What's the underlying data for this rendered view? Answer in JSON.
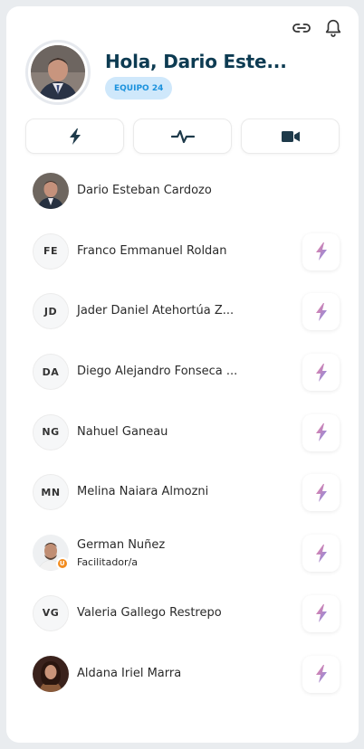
{
  "header": {
    "greeting": "Hola, Dario Este...",
    "team_badge": "EQUIPO 24",
    "icons": [
      "link-icon",
      "bell-icon"
    ]
  },
  "actions": [
    {
      "icon": "bolt-icon"
    },
    {
      "icon": "pulse-icon"
    },
    {
      "icon": "video-camera-icon"
    }
  ],
  "members": [
    {
      "name": "Dario Esteban Cardozo",
      "avatar": "photo",
      "self": true
    },
    {
      "name": "Franco Emmanuel Roldan",
      "initials": "FE"
    },
    {
      "name": "Jader Daniel Atehortúa Z...",
      "initials": "JD"
    },
    {
      "name": "Diego Alejandro Fonseca ...",
      "initials": "DA"
    },
    {
      "name": "Nahuel Ganeau",
      "initials": "NG"
    },
    {
      "name": "Melina Naiara Almozni",
      "initials": "MN"
    },
    {
      "name": "German Nuñez",
      "role": "Facilitador/a",
      "avatar": "photo",
      "badge": "facilitator"
    },
    {
      "name": "Valeria Gallego Restrepo",
      "initials": "VG"
    },
    {
      "name": "Aldana Iriel Marra",
      "avatar": "photo"
    }
  ],
  "colors": {
    "title": "#0d3b52",
    "badge_bg": "#cfe8fb",
    "badge_text": "#1b92dd",
    "bolt_gradient": [
      "#f07fa0",
      "#7e8fe8"
    ]
  }
}
